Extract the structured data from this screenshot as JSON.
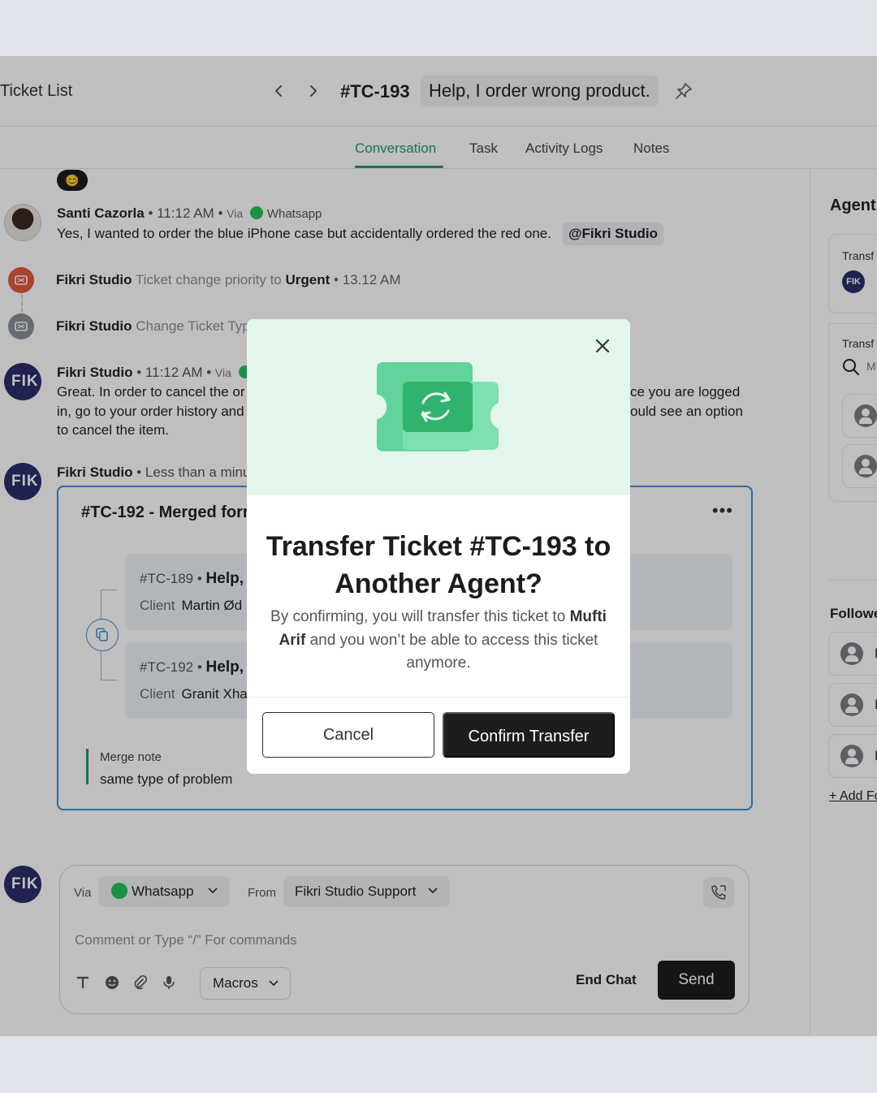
{
  "header": {
    "ticket_list_label": "Ticket List",
    "ticket_id": "#TC-193",
    "ticket_title": "Help, I order wrong product."
  },
  "tabs": [
    {
      "label": "Conversation",
      "active": true
    },
    {
      "label": "Task",
      "active": false
    },
    {
      "label": "Activity Logs",
      "active": false
    },
    {
      "label": "Notes",
      "active": false
    }
  ],
  "right_panel": {
    "title": "Agent",
    "transfer_label_1": "Transf",
    "avatar_initials": "FIK",
    "transfer_label_2": "Transf",
    "search_hint": "M",
    "followers_title": "Followe",
    "followers": [
      "F",
      "F",
      "E"
    ],
    "add_follower": "+ Add Fo"
  },
  "conversation": {
    "emoji": "😊",
    "messages": [
      {
        "author": "Santi Cazorla",
        "time": "11:12 AM",
        "via_label": "Via",
        "channel": "Whatsapp",
        "text": "Yes, I wanted to order the blue iPhone case but accidentally ordered the red one.",
        "mention": "@Fikri Studio"
      },
      {
        "author": "Fikri Studio",
        "time": "11:12 AM",
        "via_label": "Via",
        "text_left_1": "Great. In order to cancel the or",
        "text_right_1": "ce you are logged",
        "text_left_2": "in, go to your order history and",
        "text_right_2": "ould see an option",
        "text_left_3": "to cancel the item."
      }
    ],
    "events": [
      {
        "actor": "Fikri Studio",
        "action": "Ticket change priority to",
        "value": "Urgent",
        "time": "13.12 AM"
      },
      {
        "actor": "Fikri Studio",
        "action": "Change Ticket Typ"
      }
    ],
    "merge_message": {
      "author": "Fikri Studio",
      "time": "Less than a minu",
      "avatar": "FIK"
    },
    "merged_card": {
      "title": "#TC-192 - Merged forr",
      "tickets": [
        {
          "id": "#TC-189",
          "title": "Help,",
          "client_label": "Client",
          "client_name": "Martin Ød"
        },
        {
          "id": "#TC-192",
          "title": "Help,",
          "client_label": "Client",
          "client_name": "Granit Xha"
        }
      ],
      "merge_note_label": "Merge note",
      "merge_note_text": "same type of problem"
    }
  },
  "composer": {
    "avatar": "FIK",
    "via_label": "Via",
    "channel": "Whatsapp",
    "from_label": "From",
    "from_value": "Fikri Studio Support",
    "placeholder": "Comment or Type “/” For commands",
    "macros": "Macros",
    "end_chat": "End Chat",
    "send": "Send"
  },
  "modal": {
    "title": "Transfer Ticket #TC-193 to Another Agent?",
    "desc_before": "By confirming, you will transfer this ticket to",
    "desc_agent": "Mufti Arif",
    "desc_after": "and you won’t  be able to access this ticket anymore.",
    "cancel": "Cancel",
    "confirm": "Confirm Transfer"
  },
  "colors": {
    "accent_green": "#1f9d63",
    "whatsapp_green": "#25c25b",
    "merge_blue": "#3d8fd6",
    "dark_button": "#1d1d20",
    "modal_hero_bg": "#e3f6ec"
  }
}
